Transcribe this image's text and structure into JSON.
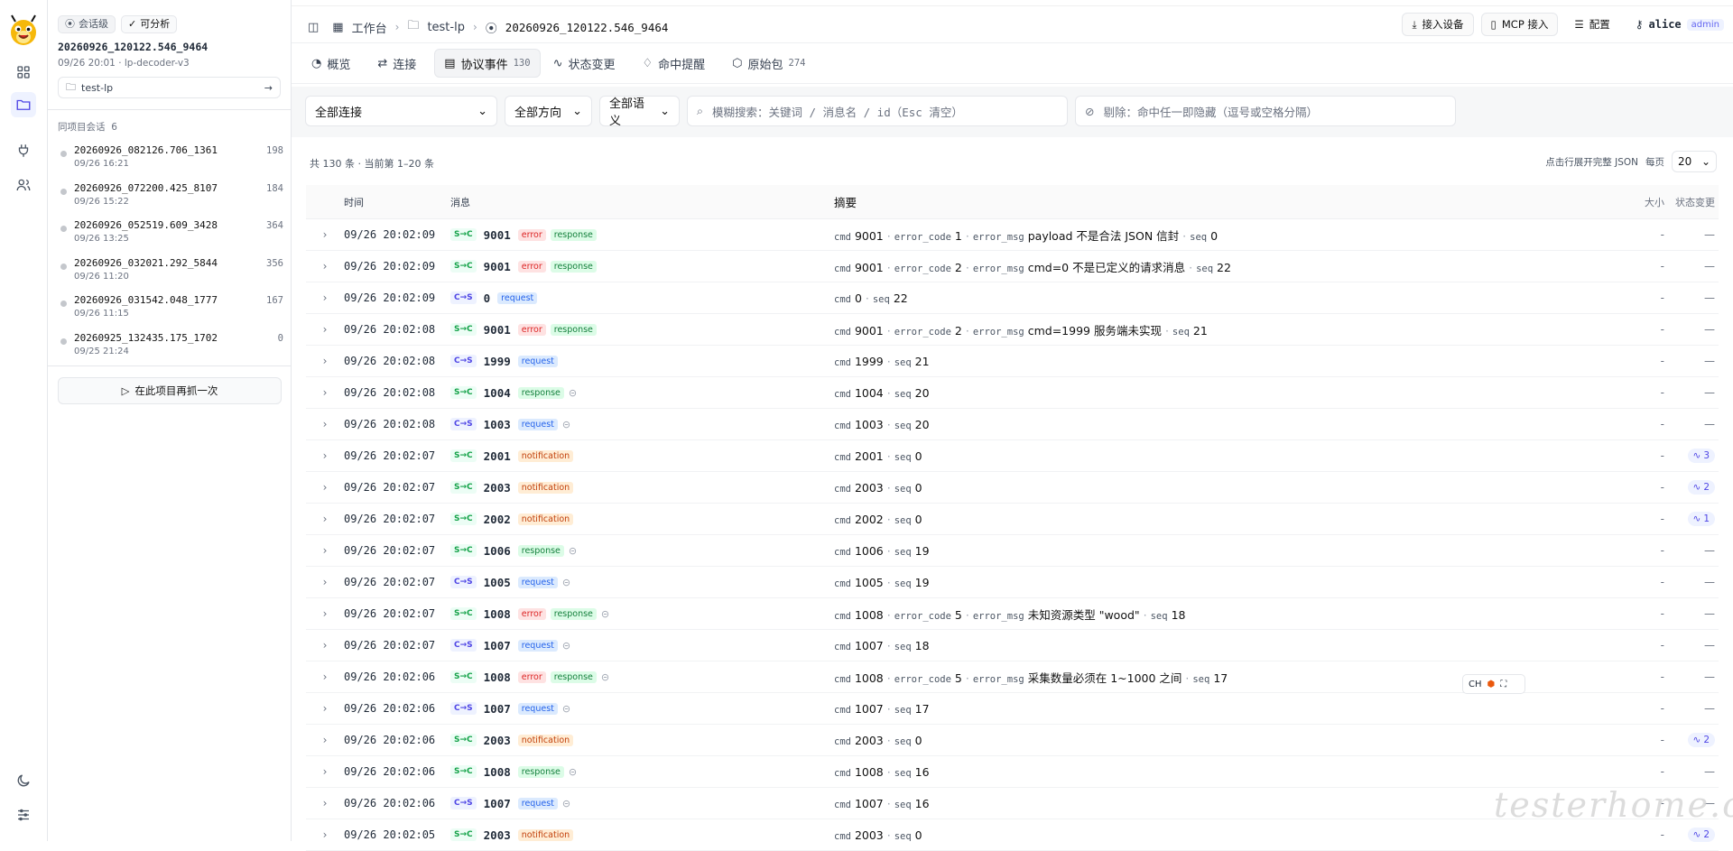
{
  "sidebar": {
    "badge_session": "会话级",
    "badge_analyzable": "可分析",
    "session_title": "20260926_120122.546_9464",
    "session_sub": "09/26 20:01 · lp-decoder-v3",
    "project_name": "test-lp",
    "group_label": "同项目会话",
    "group_count": "6",
    "sessions": [
      {
        "name": "20260926_082126.706_1361",
        "time": "09/26 16:21",
        "count": "198"
      },
      {
        "name": "20260926_072200.425_8107",
        "time": "09/26 15:22",
        "count": "184"
      },
      {
        "name": "20260926_052519.609_3428",
        "time": "09/26 13:25",
        "count": "364"
      },
      {
        "name": "20260926_032021.292_5844",
        "time": "09/26 11:20",
        "count": "356"
      },
      {
        "name": "20260926_031542.048_1777",
        "time": "09/26 11:15",
        "count": "167"
      },
      {
        "name": "20260925_132435.175_1702",
        "time": "09/25 21:24",
        "count": "0"
      }
    ],
    "recapture_label": "在此项目再抓一次"
  },
  "breadcrumb": {
    "workspace": "工作台",
    "project": "test-lp",
    "session": "20260926_120122.546_9464"
  },
  "toolbar": {
    "connect_device": "接入设备",
    "mcp": "MCP 接入",
    "config": "配置",
    "user": "alice",
    "role": "admin"
  },
  "tabs": [
    {
      "label": "概览",
      "count": ""
    },
    {
      "label": "连接",
      "count": ""
    },
    {
      "label": "协议事件",
      "count": "130"
    },
    {
      "label": "状态变更",
      "count": ""
    },
    {
      "label": "命中提醒",
      "count": ""
    },
    {
      "label": "原始包",
      "count": "274"
    }
  ],
  "filters": {
    "connection": "全部连接",
    "direction": "全部方向",
    "semantic": "全部语义",
    "search_placeholder": "模糊搜索：关键词 / 消息名 / id（Esc 清空）",
    "exclude_placeholder": "剔除：命中任一即隐藏（逗号或空格分隔）"
  },
  "summary": {
    "count_text": "共 130 条 · 当前第 1–20 条",
    "expand_hint": "点击行展开完整 JSON",
    "per_page_label": "每页",
    "per_page": "20"
  },
  "table": {
    "headers": {
      "time": "时间",
      "message": "消息",
      "summary": "摘要",
      "size": "大小",
      "state": "状态变更"
    },
    "rows": [
      {
        "time": "09/26 20:02:09",
        "dir": "S→C",
        "id": "9001",
        "tags": [
          "error",
          "response"
        ],
        "link": false,
        "sum": [
          [
            "cmd",
            "9001"
          ],
          [
            "error_code",
            "1"
          ],
          [
            "error_msg",
            "payload 不是合法 JSON 信封"
          ],
          [
            "seq",
            "0"
          ]
        ],
        "size": "-",
        "state": "—"
      },
      {
        "time": "09/26 20:02:09",
        "dir": "S→C",
        "id": "9001",
        "tags": [
          "error",
          "response"
        ],
        "link": false,
        "sum": [
          [
            "cmd",
            "9001"
          ],
          [
            "error_code",
            "2"
          ],
          [
            "error_msg",
            "cmd=0 不是已定义的请求消息"
          ],
          [
            "seq",
            "22"
          ]
        ],
        "size": "-",
        "state": "—"
      },
      {
        "time": "09/26 20:02:09",
        "dir": "C→S",
        "id": "0",
        "tags": [
          "request"
        ],
        "link": false,
        "sum": [
          [
            "cmd",
            "0"
          ],
          [
            "seq",
            "22"
          ]
        ],
        "size": "-",
        "state": "—"
      },
      {
        "time": "09/26 20:02:08",
        "dir": "S→C",
        "id": "9001",
        "tags": [
          "error",
          "response"
        ],
        "link": false,
        "sum": [
          [
            "cmd",
            "9001"
          ],
          [
            "error_code",
            "2"
          ],
          [
            "error_msg",
            "cmd=1999 服务端未实现"
          ],
          [
            "seq",
            "21"
          ]
        ],
        "size": "-",
        "state": "—"
      },
      {
        "time": "09/26 20:02:08",
        "dir": "C→S",
        "id": "1999",
        "tags": [
          "request"
        ],
        "link": false,
        "sum": [
          [
            "cmd",
            "1999"
          ],
          [
            "seq",
            "21"
          ]
        ],
        "size": "-",
        "state": "—"
      },
      {
        "time": "09/26 20:02:08",
        "dir": "S→C",
        "id": "1004",
        "tags": [
          "response"
        ],
        "link": true,
        "sum": [
          [
            "cmd",
            "1004"
          ],
          [
            "seq",
            "20"
          ]
        ],
        "size": "-",
        "state": "—"
      },
      {
        "time": "09/26 20:02:08",
        "dir": "C→S",
        "id": "1003",
        "tags": [
          "request"
        ],
        "link": true,
        "sum": [
          [
            "cmd",
            "1003"
          ],
          [
            "seq",
            "20"
          ]
        ],
        "size": "-",
        "state": "—"
      },
      {
        "time": "09/26 20:02:07",
        "dir": "S→C",
        "id": "2001",
        "tags": [
          "notification"
        ],
        "link": false,
        "sum": [
          [
            "cmd",
            "2001"
          ],
          [
            "seq",
            "0"
          ]
        ],
        "size": "-",
        "state": "3"
      },
      {
        "time": "09/26 20:02:07",
        "dir": "S→C",
        "id": "2003",
        "tags": [
          "notification"
        ],
        "link": false,
        "sum": [
          [
            "cmd",
            "2003"
          ],
          [
            "seq",
            "0"
          ]
        ],
        "size": "-",
        "state": "2"
      },
      {
        "time": "09/26 20:02:07",
        "dir": "S→C",
        "id": "2002",
        "tags": [
          "notification"
        ],
        "link": false,
        "sum": [
          [
            "cmd",
            "2002"
          ],
          [
            "seq",
            "0"
          ]
        ],
        "size": "-",
        "state": "1"
      },
      {
        "time": "09/26 20:02:07",
        "dir": "S→C",
        "id": "1006",
        "tags": [
          "response"
        ],
        "link": true,
        "sum": [
          [
            "cmd",
            "1006"
          ],
          [
            "seq",
            "19"
          ]
        ],
        "size": "-",
        "state": "—"
      },
      {
        "time": "09/26 20:02:07",
        "dir": "C→S",
        "id": "1005",
        "tags": [
          "request"
        ],
        "link": true,
        "sum": [
          [
            "cmd",
            "1005"
          ],
          [
            "seq",
            "19"
          ]
        ],
        "size": "-",
        "state": "—"
      },
      {
        "time": "09/26 20:02:07",
        "dir": "S→C",
        "id": "1008",
        "tags": [
          "error",
          "response"
        ],
        "link": true,
        "sum": [
          [
            "cmd",
            "1008"
          ],
          [
            "error_code",
            "5"
          ],
          [
            "error_msg",
            "未知资源类型 \"wood\""
          ],
          [
            "seq",
            "18"
          ]
        ],
        "size": "-",
        "state": "—"
      },
      {
        "time": "09/26 20:02:07",
        "dir": "C→S",
        "id": "1007",
        "tags": [
          "request"
        ],
        "link": true,
        "sum": [
          [
            "cmd",
            "1007"
          ],
          [
            "seq",
            "18"
          ]
        ],
        "size": "-",
        "state": "—"
      },
      {
        "time": "09/26 20:02:06",
        "dir": "S→C",
        "id": "1008",
        "tags": [
          "error",
          "response"
        ],
        "link": true,
        "sum": [
          [
            "cmd",
            "1008"
          ],
          [
            "error_code",
            "5"
          ],
          [
            "error_msg",
            "采集数量必须在 1~1000 之间"
          ],
          [
            "seq",
            "17"
          ]
        ],
        "size": "-",
        "state": "—"
      },
      {
        "time": "09/26 20:02:06",
        "dir": "C→S",
        "id": "1007",
        "tags": [
          "request"
        ],
        "link": true,
        "sum": [
          [
            "cmd",
            "1007"
          ],
          [
            "seq",
            "17"
          ]
        ],
        "size": "-",
        "state": "—"
      },
      {
        "time": "09/26 20:02:06",
        "dir": "S→C",
        "id": "2003",
        "tags": [
          "notification"
        ],
        "link": false,
        "sum": [
          [
            "cmd",
            "2003"
          ],
          [
            "seq",
            "0"
          ]
        ],
        "size": "-",
        "state": "2"
      },
      {
        "time": "09/26 20:02:06",
        "dir": "S→C",
        "id": "1008",
        "tags": [
          "response"
        ],
        "link": true,
        "sum": [
          [
            "cmd",
            "1008"
          ],
          [
            "seq",
            "16"
          ]
        ],
        "size": "-",
        "state": "—"
      },
      {
        "time": "09/26 20:02:06",
        "dir": "C→S",
        "id": "1007",
        "tags": [
          "request"
        ],
        "link": true,
        "sum": [
          [
            "cmd",
            "1007"
          ],
          [
            "seq",
            "16"
          ]
        ],
        "size": "-",
        "state": "—"
      },
      {
        "time": "09/26 20:02:05",
        "dir": "S→C",
        "id": "2003",
        "tags": [
          "notification"
        ],
        "link": false,
        "sum": [
          [
            "cmd",
            "2003"
          ],
          [
            "seq",
            "0"
          ]
        ],
        "size": "-",
        "state": "2"
      }
    ]
  },
  "overlay": {
    "ime_label": "CH",
    "watermark": "testerhome.com"
  },
  "colors": {
    "accent": "#4f46e5",
    "error": "#dc2626",
    "response": "#15803d",
    "request": "#2563eb",
    "notification": "#c2410c"
  }
}
